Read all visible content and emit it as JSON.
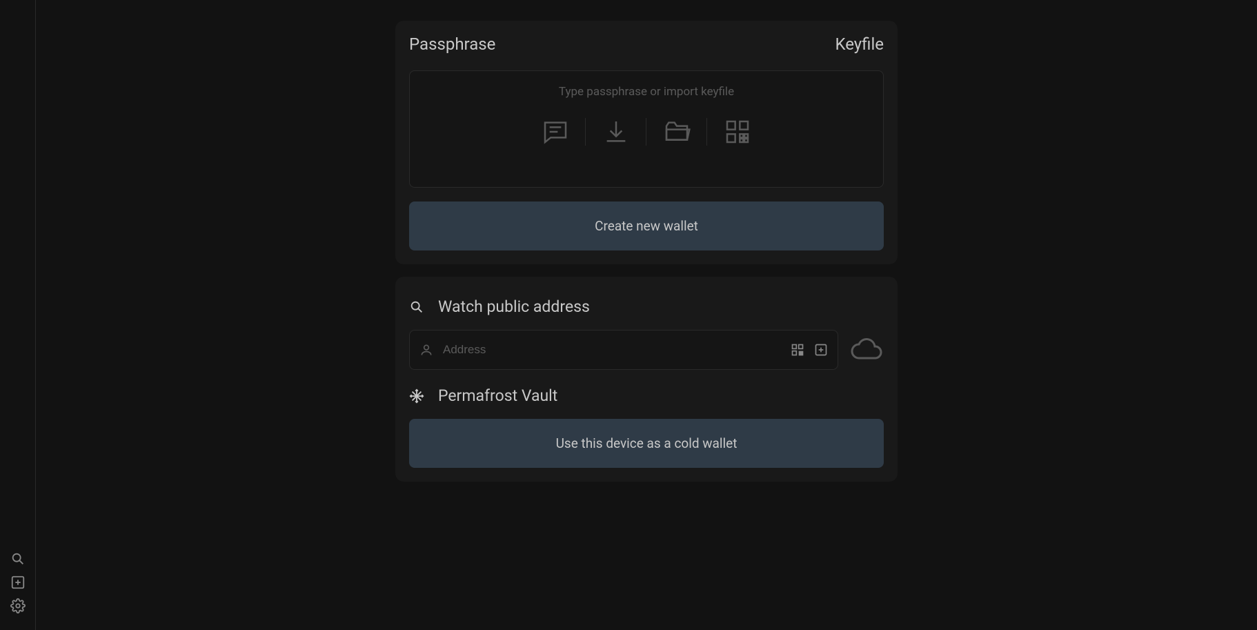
{
  "sidebar": {
    "icons": [
      "search",
      "add",
      "settings"
    ]
  },
  "passphrase_card": {
    "tab_passphrase": "Passphrase",
    "tab_keyfile": "Keyfile",
    "placeholder": "Type passphrase or import keyfile",
    "create_button": "Create new wallet"
  },
  "watch_card": {
    "section_watch": "Watch public address",
    "address_placeholder": "Address",
    "section_vault": "Permafrost Vault",
    "cold_button": "Use this device as a cold wallet"
  }
}
